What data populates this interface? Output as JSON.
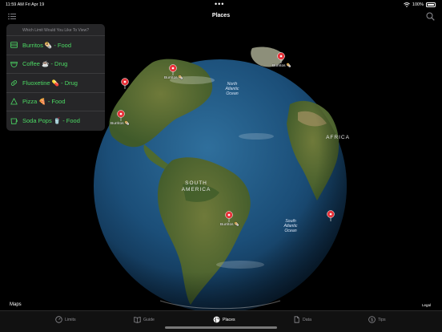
{
  "status": {
    "time": "11:59 AM  Fri Apr 19",
    "dots": "•••",
    "battery": "100%"
  },
  "nav": {
    "title": "Places"
  },
  "popover": {
    "title": "Which Limit Would You Like To View?",
    "items": [
      {
        "label": "Burritos 🌯 - Food",
        "icon": "burrito-icon"
      },
      {
        "label": "Coffee ☕ - Drug",
        "icon": "coffee-icon"
      },
      {
        "label": "Fluoxetine 💊 - Drug",
        "icon": "pill-icon"
      },
      {
        "label": "Pizza 🍕 - Food",
        "icon": "pizza-icon"
      },
      {
        "label": "Soda Pops 🥤 - Food",
        "icon": "soda-icon"
      }
    ]
  },
  "map": {
    "labels": {
      "north_atlantic": "North\nAtlantic\nOcean",
      "south_atlantic": "South\nAtlantic\nOcean",
      "south_america": "SOUTH\nAMERICA",
      "africa": "AFRICA"
    },
    "pins": [
      {
        "label": "Burritos 🌯"
      },
      {
        "label": "Burritos 🌯"
      },
      {
        "label": "Burritos 🌯"
      },
      {
        "label": "Burritos 🌯"
      },
      {
        "label": ""
      },
      {
        "label": ""
      }
    ],
    "attribution": "Maps",
    "legal": "Legal"
  },
  "tabs": [
    {
      "label": "Limits",
      "active": false
    },
    {
      "label": "Guide",
      "active": false
    },
    {
      "label": "Places",
      "active": true
    },
    {
      "label": "Data",
      "active": false
    },
    {
      "label": "Tips",
      "active": false
    }
  ],
  "colors": {
    "accent": "#4cd964",
    "pin": "#e8343c",
    "ocean": "#1d4f7a"
  }
}
